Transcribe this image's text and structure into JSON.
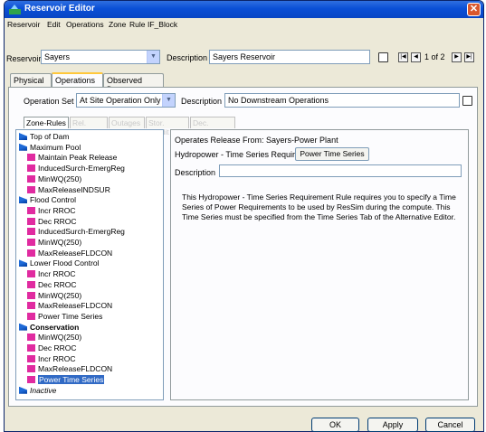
{
  "window": {
    "title": "Reservoir Editor",
    "close_glyph": "✕"
  },
  "menu": [
    "Reservoir",
    "Edit",
    "Operations",
    "Zone",
    "Rule",
    "IF_Block"
  ],
  "reservoir": {
    "label": "Reservoir",
    "value": "Sayers",
    "description_label": "Description",
    "description_value": "Sayers Reservoir",
    "page_text": "1 of 2"
  },
  "tabs": [
    "Physical",
    "Operations",
    "Observed Data"
  ],
  "operation_set": {
    "label": "Operation Set",
    "value": "At Site Operation Only",
    "description_label": "Description",
    "description_value": "No Downstream Operations"
  },
  "subtabs": [
    "Zone-Rules",
    "Rel. Alloc.",
    "Outages",
    "Stor. Credit",
    "Dec. Sched."
  ],
  "tree": [
    {
      "label": "Top of Dam",
      "icon": "zone-icon",
      "level": 0
    },
    {
      "label": "Maximum Pool",
      "icon": "zone-icon",
      "level": 0
    },
    {
      "label": "Maintain Peak Release",
      "icon": "rule-icon",
      "level": 1
    },
    {
      "label": "InducedSurch-EmergReg",
      "icon": "rule-icon",
      "level": 1
    },
    {
      "label": "MinWQ(250)",
      "icon": "rule-icon",
      "level": 1
    },
    {
      "label": "MaxReleaseINDSUR",
      "icon": "rule-icon",
      "level": 1
    },
    {
      "label": "Flood Control",
      "icon": "zone-icon",
      "level": 0
    },
    {
      "label": "Incr RROC",
      "icon": "rule-icon",
      "level": 1
    },
    {
      "label": "Dec RROC",
      "icon": "rule-icon",
      "level": 1
    },
    {
      "label": "InducedSurch-EmergReg",
      "icon": "rule-icon",
      "level": 1
    },
    {
      "label": "MinWQ(250)",
      "icon": "rule-icon",
      "level": 1
    },
    {
      "label": "MaxReleaseFLDCON",
      "icon": "rule-icon",
      "level": 1
    },
    {
      "label": "Lower Flood Control",
      "icon": "zone-icon",
      "level": 0
    },
    {
      "label": "Incr RROC",
      "icon": "rule-icon",
      "level": 1
    },
    {
      "label": "Dec RROC",
      "icon": "rule-icon",
      "level": 1
    },
    {
      "label": "MinWQ(250)",
      "icon": "rule-icon",
      "level": 1
    },
    {
      "label": "MaxReleaseFLDCON",
      "icon": "rule-icon",
      "level": 1
    },
    {
      "label": "Power Time Series",
      "icon": "rule-icon",
      "level": 1
    },
    {
      "label": "Conservation",
      "icon": "zone-icon",
      "level": 0,
      "bold": true
    },
    {
      "label": "MinWQ(250)",
      "icon": "rule-icon",
      "level": 1
    },
    {
      "label": "Dec RROC",
      "icon": "rule-icon",
      "level": 1
    },
    {
      "label": "Incr RROC",
      "icon": "rule-icon",
      "level": 1
    },
    {
      "label": "MaxReleaseFLDCON",
      "icon": "rule-icon",
      "level": 1
    },
    {
      "label": "Power Time Series",
      "icon": "rule-icon",
      "level": 1,
      "selected": true
    },
    {
      "label": "Inactive",
      "icon": "zone-icon",
      "level": 0,
      "italic": true
    }
  ],
  "rule_panel": {
    "operates_from": "Operates Release From: Sayers-Power Plant",
    "requirement_label": "Hydropower - Time Series Requirement",
    "requirement_button": "Power Time Series",
    "description_label": "Description",
    "description_value": "",
    "info_text": "This Hydropower - Time Series Requirement Rule requires you to specify a Time Series of Power Requirements to be used by ResSim during the compute. This Time Series must be specified from the Time Series Tab of the Alternative Editor."
  },
  "buttons": {
    "ok": "OK",
    "apply": "Apply",
    "cancel": "Cancel"
  },
  "nav": {
    "first": "|◀",
    "prev": "◀",
    "next": "▶",
    "last": "▶|"
  },
  "colors": {
    "title_bar": "#0a4fd6",
    "zone_icon": "#1f6bd8",
    "rule_icon": "#e02ba0",
    "selection": "#316ac5"
  }
}
